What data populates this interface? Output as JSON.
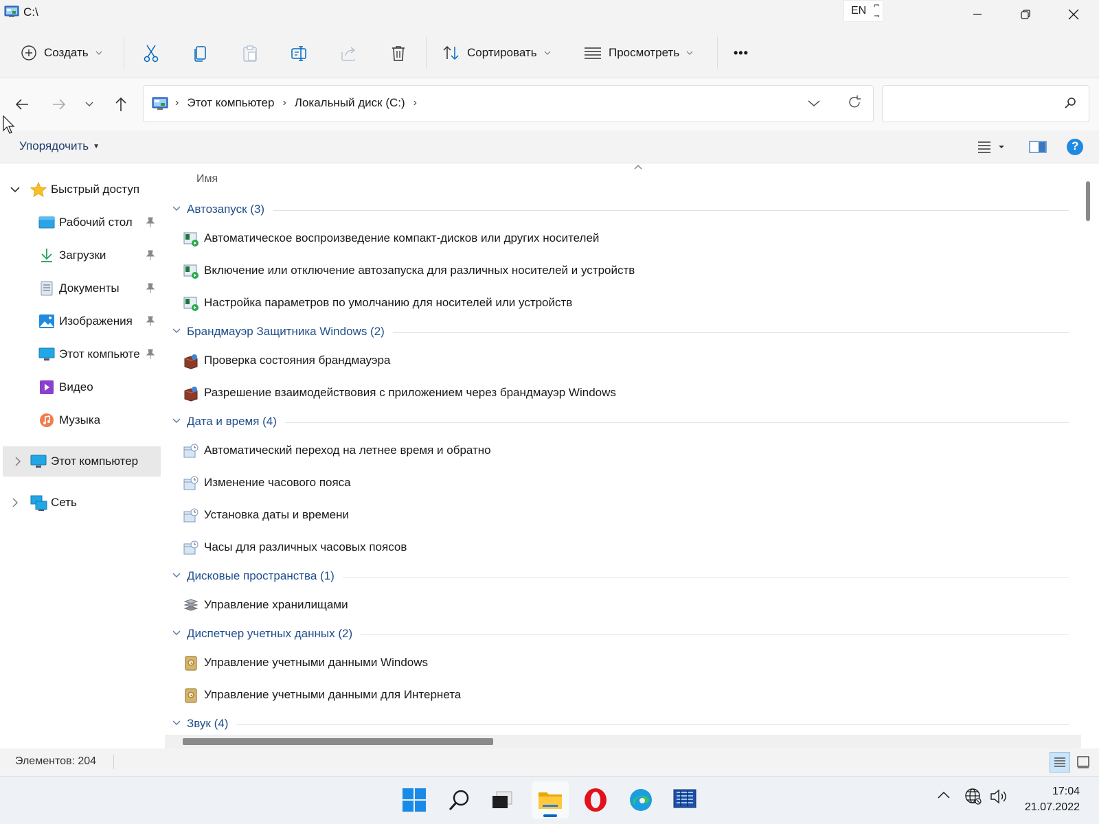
{
  "window": {
    "title": "C:\\",
    "language": "EN"
  },
  "command_bar": {
    "new_label": "Создать",
    "sort_label": "Сортировать",
    "view_label": "Просмотреть",
    "more_label": "•••"
  },
  "address_bar": {
    "crumbs": [
      "Этот компьютер",
      "Локальный диск (C:)"
    ],
    "separator": "›"
  },
  "search": {
    "placeholder": "",
    "value": ""
  },
  "organize": {
    "label": "Упорядочить",
    "help": "?"
  },
  "sidebar": {
    "quick_access": "Быстрый доступ",
    "items": [
      {
        "label": "Рабочий стол",
        "icon": "desktop-folder-icon",
        "pinned": true
      },
      {
        "label": "Загрузки",
        "icon": "download-arrow-icon",
        "pinned": true
      },
      {
        "label": "Документы",
        "icon": "documents-icon",
        "pinned": true
      },
      {
        "label": "Изображения",
        "icon": "pictures-icon",
        "pinned": true
      },
      {
        "label": "Этот компьюте",
        "icon": "monitor-icon",
        "pinned": true
      },
      {
        "label": "Видео",
        "icon": "video-icon",
        "pinned": false
      },
      {
        "label": "Музыка",
        "icon": "music-icon",
        "pinned": false
      }
    ],
    "this_pc": "Этот компьютер",
    "network": "Сеть"
  },
  "content": {
    "column_header": "Имя",
    "groups": [
      {
        "label": "Автозапуск (3)",
        "items": [
          "Автоматическое воспроизведение компакт-дисков или других носителей",
          "Включение или отключение автозапуска для различных носителей и устройств",
          "Настройка параметров по умолчанию для носителей или устройств"
        ]
      },
      {
        "label": "Брандмауэр Защитника Windows (2)",
        "items": [
          "Проверка состояния брандмауэра",
          "Разрешение взаимодействовия с приложением через брандмауэр Windows"
        ]
      },
      {
        "label": "Дата и время (4)",
        "items": [
          "Автоматический переход на летнее время и обратно",
          "Изменение часового пояса",
          "Установка даты и времени",
          "Часы для различных часовых поясов"
        ]
      },
      {
        "label": "Дисковые пространства (1)",
        "items": [
          "Управление хранилищами"
        ]
      },
      {
        "label": "Диспетчер учетных данных (2)",
        "items": [
          "Управление учетными данными Windows",
          "Управление учетными данными для Интернета"
        ]
      },
      {
        "label": "Звук (4)",
        "items": []
      }
    ]
  },
  "status_bar": {
    "item_count": "Элементов: 204"
  },
  "taskbar": {
    "apps": [
      "windows-start-icon",
      "search-icon",
      "task-view-icon",
      "file-explorer-icon",
      "opera-icon",
      "edge-icon",
      "control-panel-icon"
    ],
    "time": "17:04",
    "date": "21.07.2022"
  },
  "colors": {
    "accent": "#0067c0",
    "group_header": "#1f4e8c",
    "chrome_bg": "#f3f3f3"
  }
}
